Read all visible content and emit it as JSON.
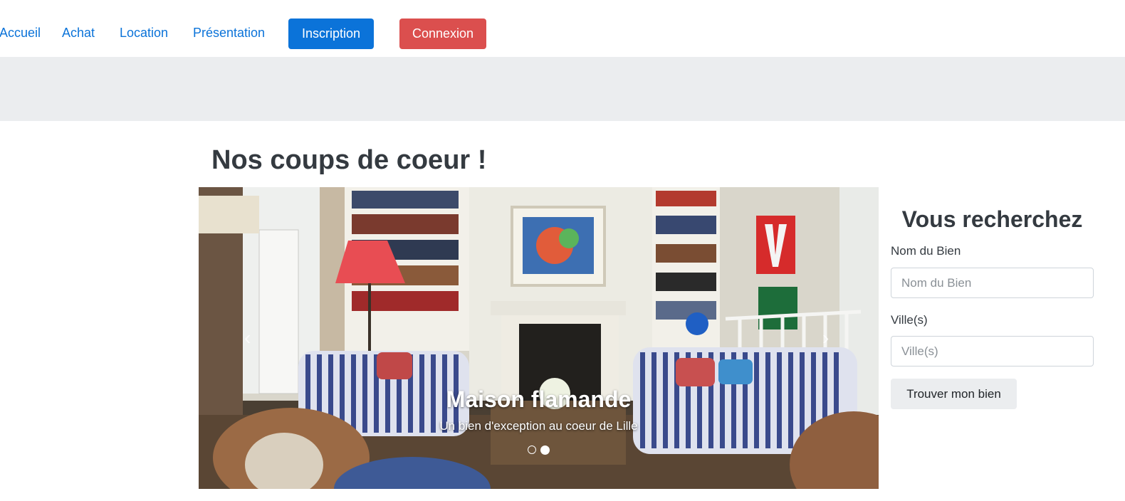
{
  "nav": {
    "links": [
      "Accueil",
      "Achat",
      "Location",
      "Présentation"
    ],
    "inscription_label": "Inscription",
    "connexion_label": "Connexion"
  },
  "main": {
    "title": "Nos coups de coeur !"
  },
  "carousel": {
    "slide_title": "Maison flamande",
    "slide_subtitle": "Un bien d'exception au coeur de Lille",
    "prev_icon": "‹",
    "next_icon": "›",
    "slide_count": 2,
    "active_index": 1
  },
  "search": {
    "title": "Vous recherchez",
    "name_label": "Nom du Bien",
    "name_placeholder": "Nom du Bien",
    "name_value": "",
    "city_label": "Ville(s)",
    "city_placeholder": "Ville(s)",
    "city_value": "",
    "submit_label": "Trouver mon bien"
  },
  "colors": {
    "link": "#0b73d9",
    "primary": "#0b73d9",
    "danger": "#db4f4e",
    "band": "#ebedef",
    "text": "#343a40"
  }
}
